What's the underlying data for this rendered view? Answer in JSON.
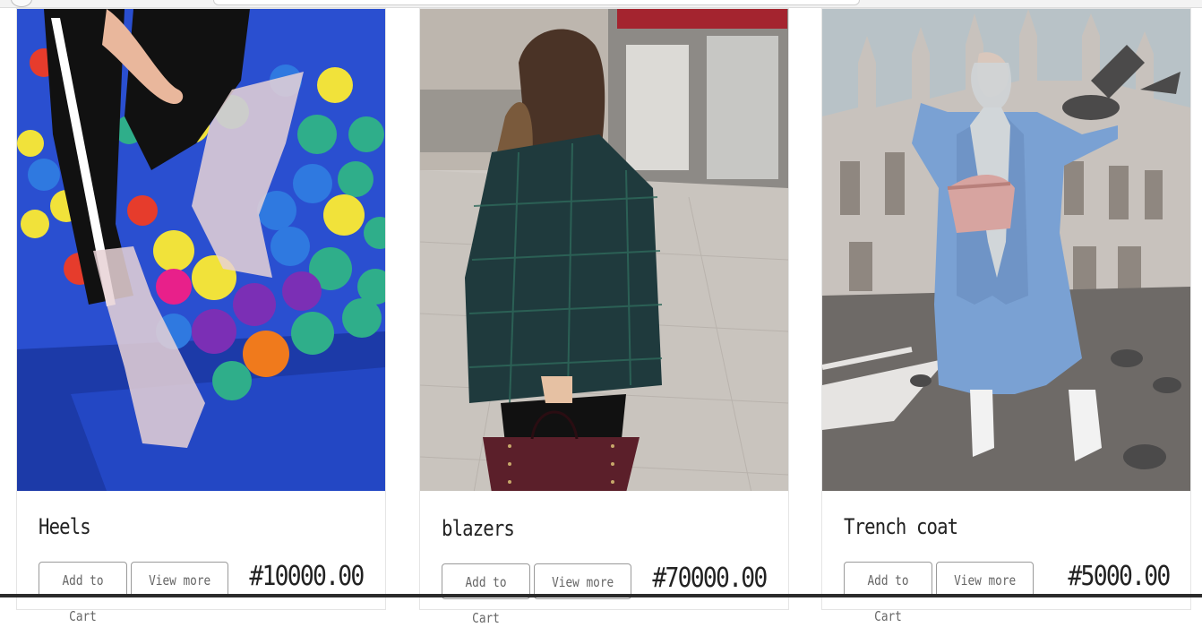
{
  "products": [
    {
      "name": "Heels",
      "price": "#10000.00",
      "add_to_cart_label": "Add to Cart",
      "view_more_label": "View more",
      "image_icon": "heels-photo"
    },
    {
      "name": "blazers",
      "price": "#70000.00",
      "add_to_cart_label": "Add to Cart",
      "view_more_label": "View more",
      "image_icon": "blazer-photo"
    },
    {
      "name": "Trench coat",
      "price": "#5000.00",
      "add_to_cart_label": "Add to Cart",
      "view_more_label": "View more",
      "image_icon": "trench-coat-photo"
    }
  ],
  "colors": {
    "text": "#222222",
    "button_border": "#9a9a9a",
    "button_text": "#666666",
    "card_border": "#e5e5e5"
  }
}
